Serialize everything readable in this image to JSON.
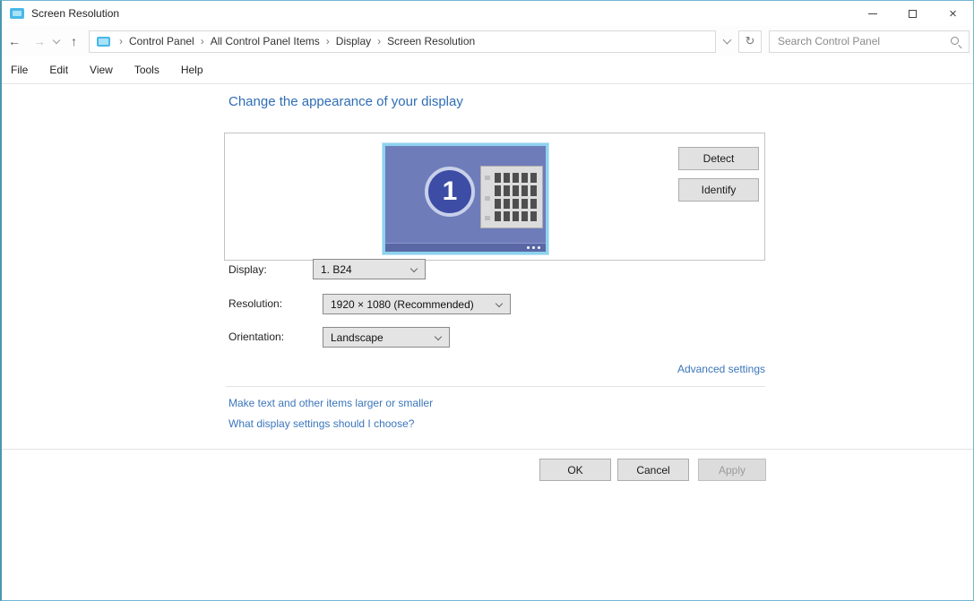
{
  "window": {
    "title": "Screen Resolution"
  },
  "icons": {
    "back": "←",
    "forward": "→",
    "up": "↑",
    "refresh": "↻",
    "crumb_sep": "›",
    "close": "×"
  },
  "address_bar": {
    "breadcrumb": [
      "Control Panel",
      "All Control Panel Items",
      "Display",
      "Screen Resolution"
    ],
    "search_placeholder": "Search Control Panel"
  },
  "menu_bar": {
    "items": [
      "File",
      "Edit",
      "View",
      "Tools",
      "Help"
    ]
  },
  "main": {
    "heading": "Change the appearance of your display",
    "monitor_number": "1",
    "detect_label": "Detect",
    "identify_label": "Identify",
    "fields": [
      {
        "label": "Display:",
        "value": "1. B24"
      },
      {
        "label": "Resolution:",
        "value": "1920 × 1080 (Recommended)"
      },
      {
        "label": "Orientation:",
        "value": "Landscape"
      }
    ],
    "links": {
      "advanced": "Advanced settings",
      "make_text": "Make text and other items larger or smaller",
      "what_settings": "What display settings should I choose?"
    },
    "footer": {
      "ok": "OK",
      "cancel": "Cancel",
      "apply": "Apply"
    }
  },
  "colors": {
    "heading_blue": "#2e6db5",
    "link_blue": "#3b76bb",
    "monitor_screen": "#6e7cb9",
    "monitor_border": "#8ed2ee",
    "circle_blue": "#3d4da5",
    "button_face": "#e1e1e1",
    "button_border": "#adadad",
    "disabled_text": "#9a9a9a",
    "window_border": "#4a97ad"
  }
}
